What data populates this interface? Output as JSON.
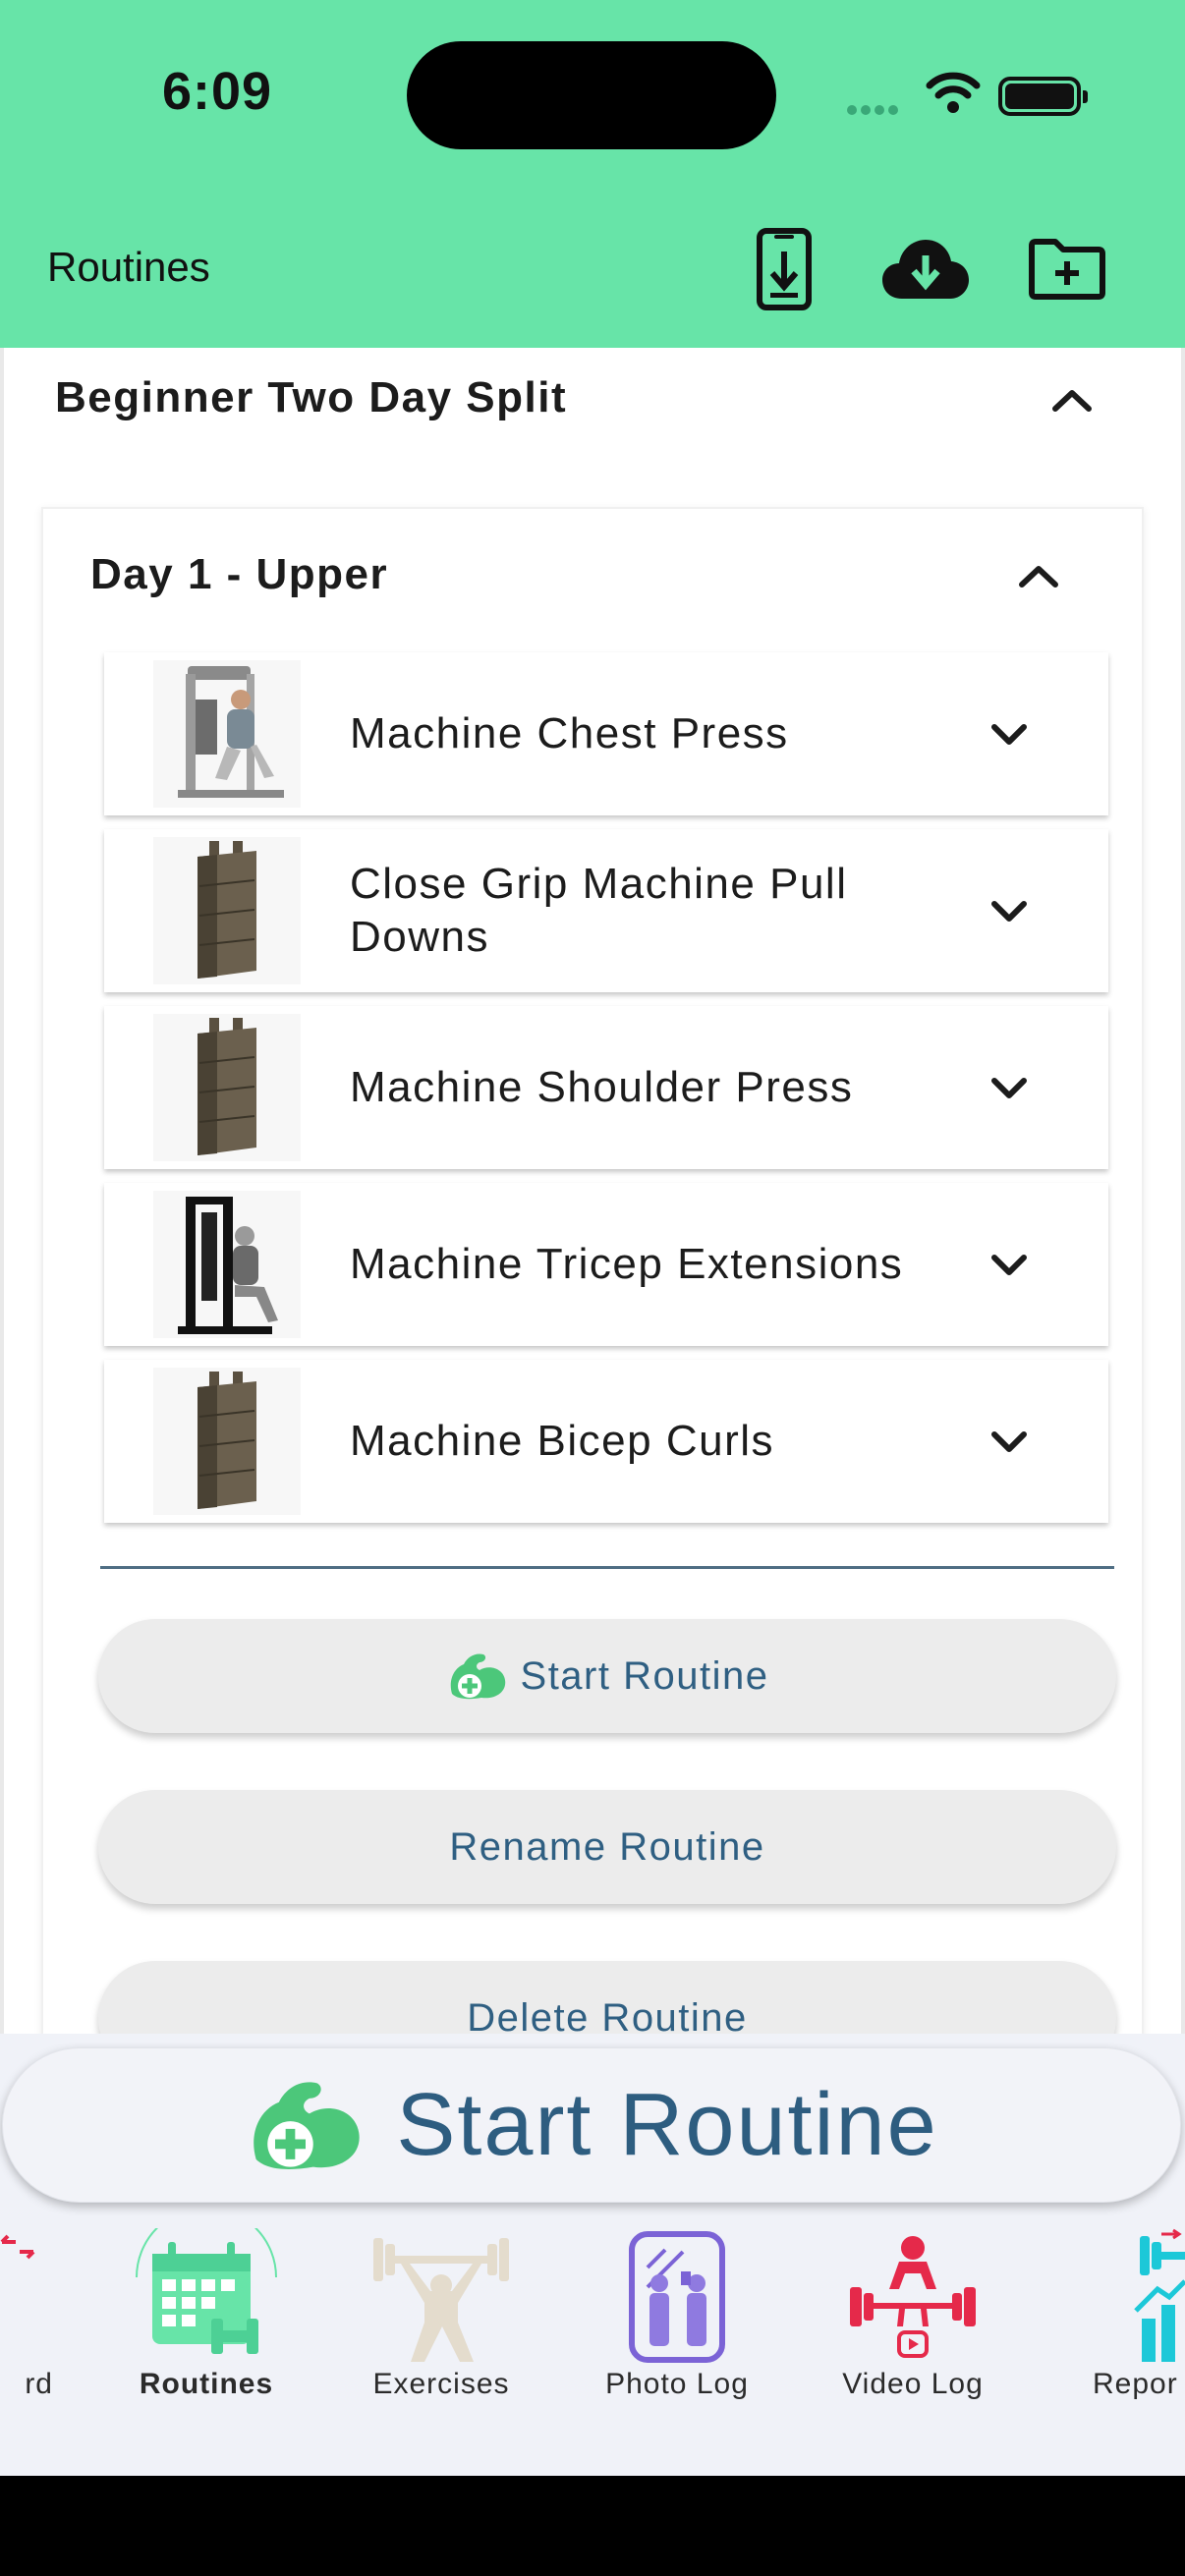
{
  "status_bar": {
    "time": "6:09"
  },
  "app_bar": {
    "title": "Routines",
    "actions": [
      "phone-download-icon",
      "cloud-download-icon",
      "folder-add-icon"
    ]
  },
  "routine": {
    "title": "Beginner Two Day Split",
    "day": {
      "title": "Day 1 - Upper",
      "exercises": [
        {
          "name": "Machine Chest Press",
          "thumb": "chest-press-machine"
        },
        {
          "name": "Close Grip Machine Pull Downs",
          "thumb": "weight-stack"
        },
        {
          "name": "Machine Shoulder Press",
          "thumb": "weight-stack"
        },
        {
          "name": "Machine Tricep Extensions",
          "thumb": "tricep-machine"
        },
        {
          "name": "Machine Bicep Curls",
          "thumb": "weight-stack"
        }
      ]
    },
    "actions": {
      "start": "Start Routine",
      "rename": "Rename Routine",
      "delete": "Delete Routine"
    }
  },
  "floating_button": {
    "label": "Start Routine"
  },
  "nav": {
    "items": [
      {
        "label": "rd",
        "icon": "dashboard-icon"
      },
      {
        "label": "Routines",
        "icon": "calendar-dumbbell-icon",
        "active": true
      },
      {
        "label": "Exercises",
        "icon": "weightlifter-icon"
      },
      {
        "label": "Photo Log",
        "icon": "mirror-photo-icon"
      },
      {
        "label": "Video Log",
        "icon": "deadlift-video-icon"
      },
      {
        "label": "Repor",
        "icon": "report-chart-icon"
      }
    ]
  },
  "colors": {
    "app_bar": "#67e4a8",
    "accent_blue": "#2f5f82",
    "brand_green": "#4cc77a",
    "nav_purple": "#7b63d6",
    "nav_red": "#e5294a",
    "nav_cyan": "#1cc8d8"
  }
}
